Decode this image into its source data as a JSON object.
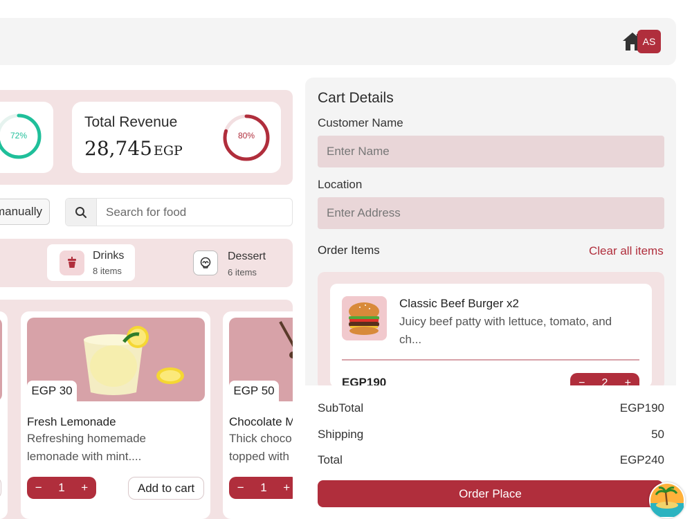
{
  "header": {
    "avatar_initials": "AS",
    "icons": [
      "home-icon"
    ]
  },
  "stats": {
    "left_ring_percent": "72%",
    "revenue_title": "Total Revenue",
    "revenue_value": "28,745",
    "revenue_unit": "EGP",
    "revenue_ring_percent": "80%",
    "left_ring_fraction": 0.72,
    "revenue_ring_fraction": 0.8,
    "colors": {
      "left_ring": "#1fbf9a",
      "revenue_ring": "#b02e3c"
    }
  },
  "search": {
    "manual_button_label": "manually",
    "placeholder": "Search for food"
  },
  "categories": [
    {
      "name": "Drinks",
      "count": "8 items",
      "icon": "cup-icon"
    },
    {
      "name": "Dessert",
      "count": "6 items",
      "icon": "cupcake-icon"
    }
  ],
  "products": [
    {
      "price": "EGP 30",
      "name": "Fresh Lemonade",
      "desc_line1": "Refreshing homemade",
      "desc_line2": "lemonade with mint....",
      "qty": "1",
      "add_label": "Add to cart"
    },
    {
      "price": "EGP 50",
      "name": "Chocolate M",
      "desc_line1": "Thick choco",
      "desc_line2": "topped with",
      "qty": "1"
    }
  ],
  "cart": {
    "title": "Cart Details",
    "customer_label": "Customer Name",
    "customer_placeholder": "Enter Name",
    "location_label": "Location",
    "location_placeholder": "Enter Address",
    "order_items_label": "Order Items",
    "clear_label": "Clear all items",
    "item": {
      "name": "Classic Beef Burger x2",
      "desc": "Juicy beef patty with lettuce, tomato, and ch...",
      "price": "EGP190",
      "qty": "2"
    },
    "subtotal_label": "SubTotal",
    "subtotal_value": "EGP190",
    "shipping_label": "Shipping",
    "shipping_value": "50",
    "total_label": "Total",
    "total_value": "EGP240",
    "order_button": "Order Place"
  }
}
